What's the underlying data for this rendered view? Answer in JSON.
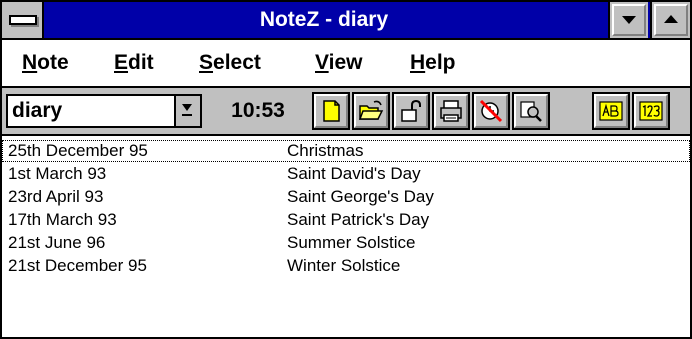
{
  "window": {
    "title": "NoteZ - diary"
  },
  "menubar": {
    "items": [
      {
        "acc": "N",
        "rest": "ote"
      },
      {
        "acc": "E",
        "rest": "dit"
      },
      {
        "acc": "S",
        "rest": "elect"
      },
      {
        "acc": "V",
        "rest": "iew"
      },
      {
        "acc": "H",
        "rest": "elp"
      }
    ]
  },
  "toolbar": {
    "note_selector": "diary",
    "clock": "10:53",
    "tools": [
      "new-note",
      "open-folder",
      "unlock",
      "print",
      "alarm-clock",
      "find",
      "sort-alpha",
      "sort-numeric"
    ]
  },
  "notes": [
    {
      "date": "25th December 95",
      "title": "Christmas"
    },
    {
      "date": "1st March 93",
      "title": "Saint David's Day"
    },
    {
      "date": "23rd April 93",
      "title": "Saint George's Day"
    },
    {
      "date": "17th March 93",
      "title": "Saint Patrick's Day"
    },
    {
      "date": "21st June 96",
      "title": "Summer Solstice"
    },
    {
      "date": "21st December 95",
      "title": "Winter Solstice"
    }
  ],
  "colors": {
    "titlebar": "#0000a8",
    "face": "#c0c0c0",
    "icon_yellow": "#ffff00",
    "alarm_red": "#ff0000"
  }
}
